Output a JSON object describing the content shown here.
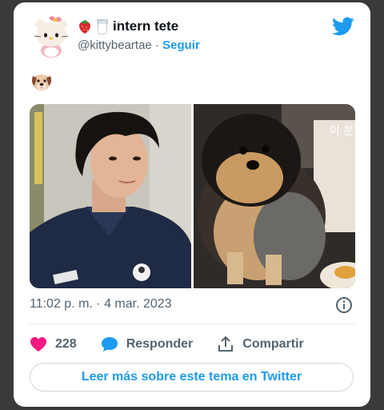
{
  "tweet": {
    "display_name": "intern tete",
    "handle": "@kittybeartae",
    "separator": "·",
    "follow_label": "Seguir",
    "timestamp": "11:02 p. m. · 4 mar. 2023",
    "likes_count": "228",
    "reply_label": "Responder",
    "share_label": "Compartir",
    "read_more_label": "Leer más sobre este tema en Twitter",
    "photo_overlay_text": "이 분"
  },
  "icons": [
    "strawberry-emoji",
    "milk-glass-emoji",
    "dog-face-emoji",
    "twitter-bird-icon",
    "info-icon",
    "heart-icon",
    "reply-bubble-icon",
    "share-icon"
  ],
  "colors": {
    "accent": "#1d9bf0",
    "like": "#f91880",
    "text_primary": "#0f1419",
    "text_secondary": "#536471"
  }
}
